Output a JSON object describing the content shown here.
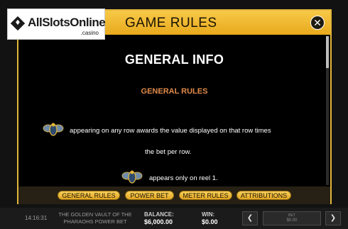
{
  "logo": {
    "brand": "AllSlotsOnline",
    "sub": ".casino",
    "glyph": "♦"
  },
  "modal": {
    "title": "GAME RULES",
    "close_glyph": "✕",
    "heading": "GENERAL INFO",
    "subheading": "GENERAL RULES",
    "para1_line1": "appearing on any row awards the value displayed on that row times",
    "para1_line2": "the bet per row.",
    "para2": "appears only on reel 1.",
    "tabs": [
      "GENERAL RULES",
      "POWER BET",
      "METER RULES",
      "ATTRIBUTIONS"
    ],
    "scarab_icon": "scarab-icon"
  },
  "bottombar": {
    "time": "14:16:31",
    "game_title": "THE GOLDEN VAULT OF THE PHARAOHS POWER BET",
    "balance_label": "BALANCE:",
    "balance_value": "$6,000.00",
    "win_label": "WIN:",
    "win_value": "$0.00",
    "prev_glyph": "❮",
    "next_glyph": "❯",
    "bet_label": "BET",
    "bet_value": "$0.00"
  },
  "colors": {
    "accent": "#e8a91c",
    "subheading": "#e08a4a"
  }
}
